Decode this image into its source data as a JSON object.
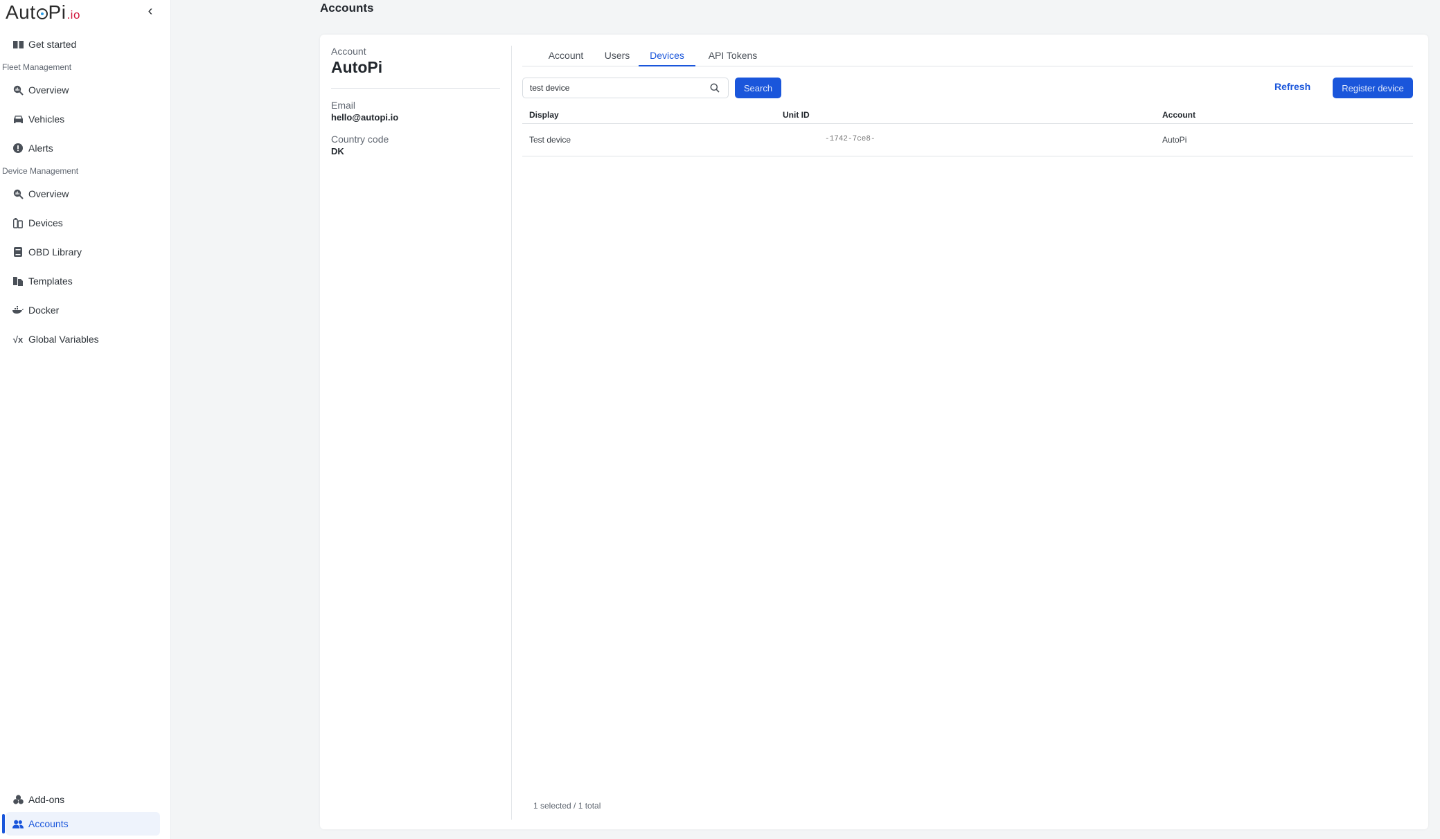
{
  "sidebar": {
    "logo": {
      "main_a": "Aut",
      "main_b": "Pi",
      "suffix": ".io"
    },
    "collapse_icon": "‹",
    "items_top": [
      {
        "label": "Get started",
        "icon": "book-icon"
      }
    ],
    "sections": [
      {
        "title": "Fleet Management",
        "items": [
          {
            "label": "Overview",
            "icon": "search-chart-icon"
          },
          {
            "label": "Vehicles",
            "icon": "car-icon"
          },
          {
            "label": "Alerts",
            "icon": "alert-circle-icon"
          }
        ]
      },
      {
        "title": "Device Management",
        "items": [
          {
            "label": "Overview",
            "icon": "search-chart-icon"
          },
          {
            "label": "Devices",
            "icon": "devices-icon"
          },
          {
            "label": "OBD Library",
            "icon": "book-closed-icon"
          },
          {
            "label": "Templates",
            "icon": "files-icon"
          },
          {
            "label": "Docker",
            "icon": "docker-icon"
          },
          {
            "label": "Global Variables",
            "icon": "sqrt-x-icon"
          }
        ]
      }
    ],
    "items_bottom": [
      {
        "label": "Add-ons",
        "icon": "cubes-icon"
      },
      {
        "label": "Accounts",
        "icon": "users-icon",
        "active": true
      }
    ]
  },
  "page": {
    "title": "Accounts"
  },
  "account": {
    "label": "Account",
    "name": "AutoPi",
    "email_label": "Email",
    "email": "hello@autopi.io",
    "country_label": "Country code",
    "country": "DK"
  },
  "tabs": [
    {
      "label": "Account",
      "active": false
    },
    {
      "label": "Users",
      "active": false
    },
    {
      "label": "Devices",
      "active": true
    },
    {
      "label": "API Tokens",
      "active": false
    }
  ],
  "search": {
    "value": "test device",
    "button": "Search"
  },
  "actions": {
    "refresh": "Refresh",
    "register": "Register device"
  },
  "table": {
    "headers": [
      "Display",
      "Unit ID",
      "Account"
    ],
    "rows": [
      {
        "display": "Test device",
        "unit_id": "-1742-7ce8-",
        "account": "AutoPi"
      }
    ]
  },
  "footer": {
    "count": "1 selected / 1 total"
  },
  "colors": {
    "accent": "#1a56db",
    "logo_red": "#d1163b"
  }
}
